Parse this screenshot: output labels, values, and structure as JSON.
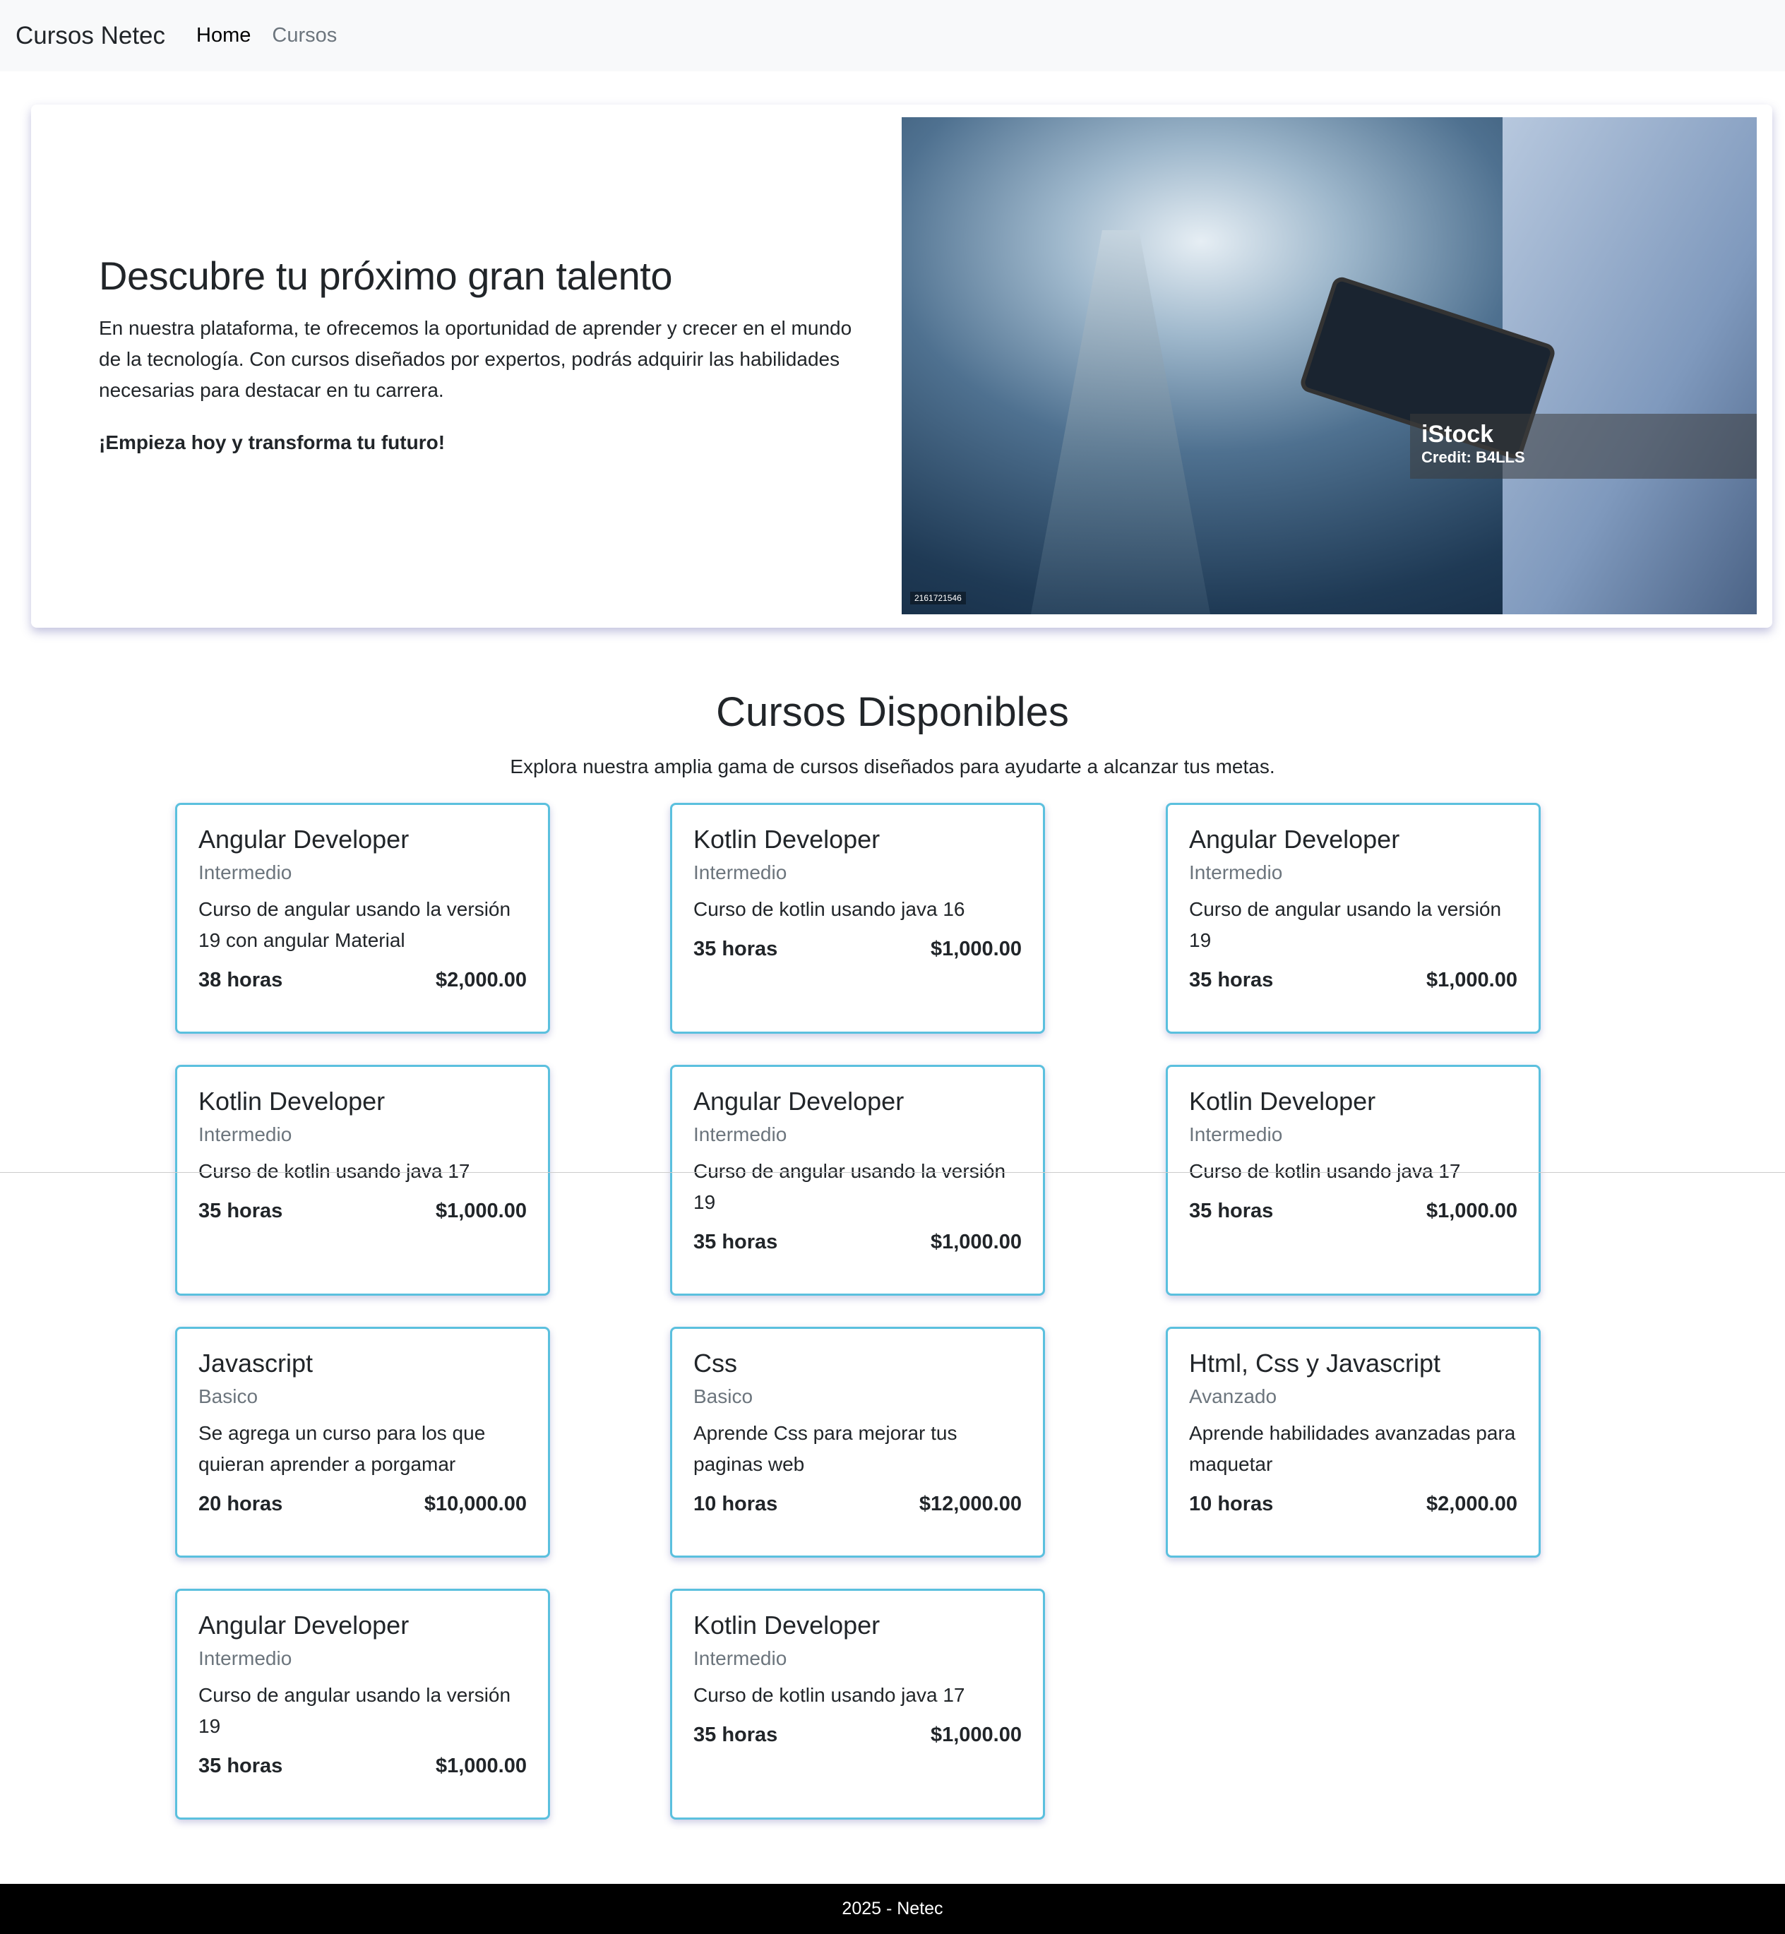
{
  "navbar": {
    "brand": "Cursos Netec",
    "links": [
      {
        "label": "Home",
        "active": true
      },
      {
        "label": "Cursos",
        "active": false
      }
    ]
  },
  "hero": {
    "title": "Descubre tu próximo gran talento",
    "paragraph": "En nuestra plataforma, te ofrecemos la oportunidad de aprender y crecer en el mundo de la tecnología. Con cursos diseñados por expertos, podrás adquirir las habilidades necesarias para destacar en tu carrera.",
    "cta": "¡Empieza hoy y transforma tu futuro!",
    "image": {
      "watermark": "iStock",
      "credit": "Credit: B4LLS",
      "id": "2161721546"
    }
  },
  "courses_section": {
    "title": "Cursos Disponibles",
    "subtitle": "Explora nuestra amplia gama de cursos diseñados para ayudarte a alcanzar tus metas."
  },
  "courses": [
    {
      "title": "Angular Developer",
      "level": "Intermedio",
      "description": "Curso de angular usando la versión 19 con angular Material",
      "hours": "38 horas",
      "price": "$2,000.00"
    },
    {
      "title": "Kotlin Developer",
      "level": "Intermedio",
      "description": "Curso de kotlin usando java 16",
      "hours": "35 horas",
      "price": "$1,000.00"
    },
    {
      "title": "Angular Developer",
      "level": "Intermedio",
      "description": "Curso de angular usando la versión 19",
      "hours": "35 horas",
      "price": "$1,000.00"
    },
    {
      "title": "Kotlin Developer",
      "level": "Intermedio",
      "description": "Curso de kotlin usando java 17",
      "hours": "35 horas",
      "price": "$1,000.00"
    },
    {
      "title": "Angular Developer",
      "level": "Intermedio",
      "description": "Curso de angular usando la versión 19",
      "hours": "35 horas",
      "price": "$1,000.00"
    },
    {
      "title": "Kotlin Developer",
      "level": "Intermedio",
      "description": "Curso de kotlin usando java 17",
      "hours": "35 horas",
      "price": "$1,000.00"
    },
    {
      "title": "Javascript",
      "level": "Basico",
      "description": "Se agrega un curso para los que quieran aprender a porgamar",
      "hours": "20 horas",
      "price": "$10,000.00"
    },
    {
      "title": "Css",
      "level": "Basico",
      "description": "Aprende Css para mejorar tus paginas web",
      "hours": "10 horas",
      "price": "$12,000.00"
    },
    {
      "title": "Html, Css y Javascript",
      "level": "Avanzado",
      "description": "Aprende habilidades avanzadas para maquetar",
      "hours": "10 horas",
      "price": "$2,000.00"
    },
    {
      "title": "Angular Developer",
      "level": "Intermedio",
      "description": "Curso de angular usando la versión 19",
      "hours": "35 horas",
      "price": "$1,000.00"
    },
    {
      "title": "Kotlin Developer",
      "level": "Intermedio",
      "description": "Curso de kotlin usando java 17",
      "hours": "35 horas",
      "price": "$1,000.00"
    }
  ],
  "footer": {
    "text": "2025 - Netec"
  }
}
